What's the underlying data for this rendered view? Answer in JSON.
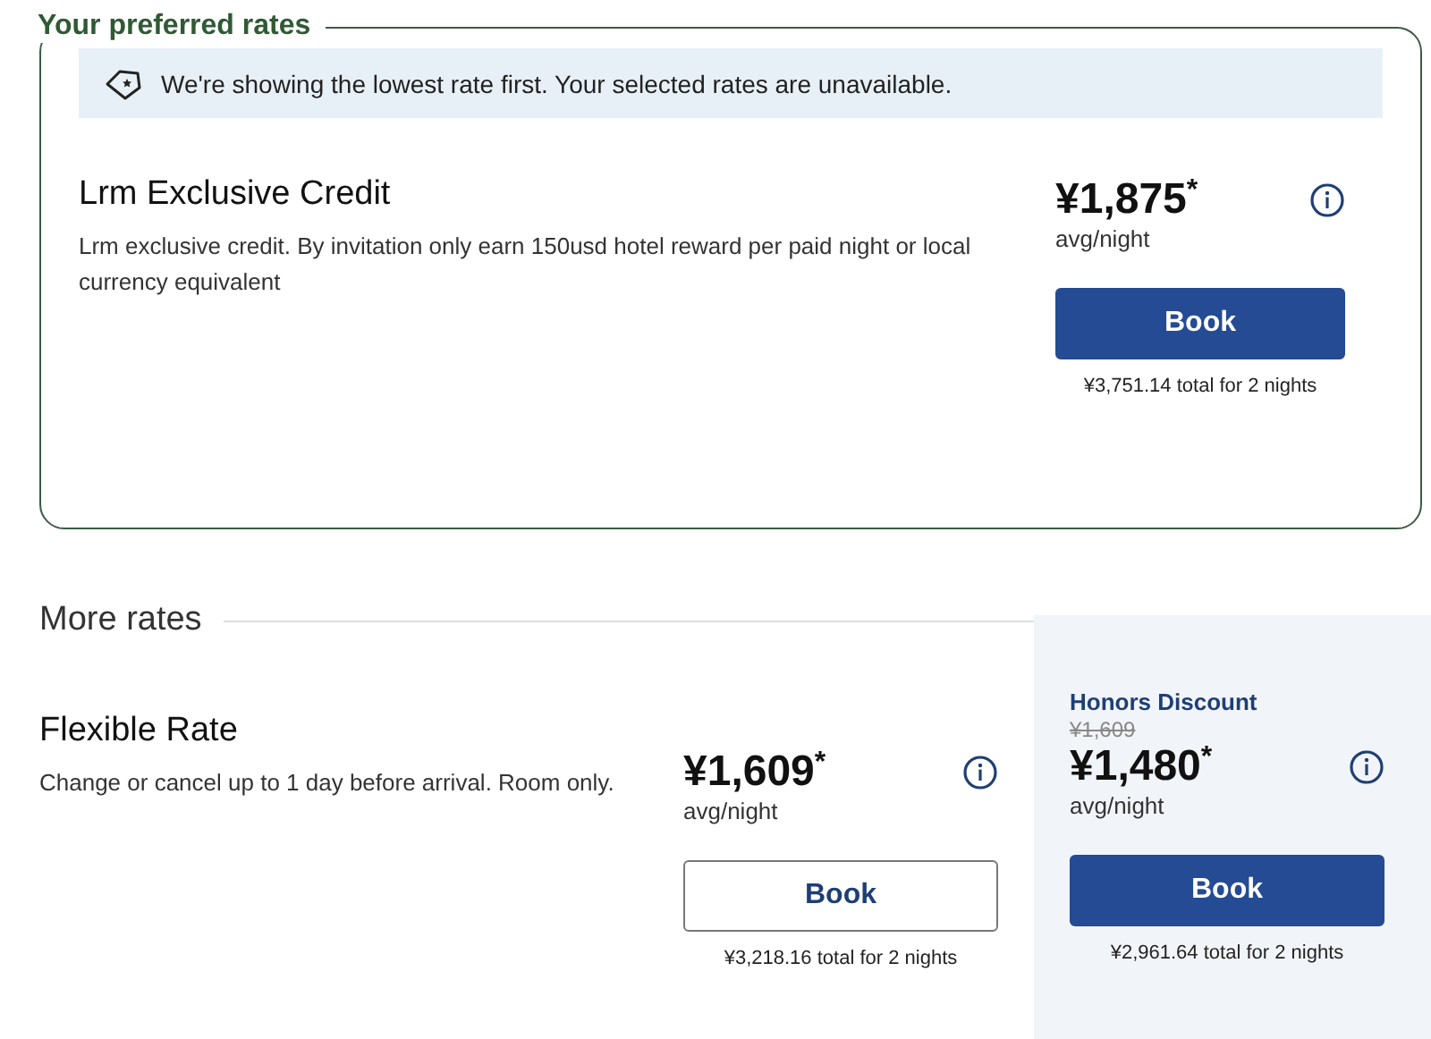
{
  "preferred": {
    "legend": "Your preferred rates",
    "notice": "We're showing the lowest rate first. Your selected rates are unavailable.",
    "rate": {
      "name": "Lrm Exclusive Credit",
      "description": "Lrm exclusive credit. By invitation only earn 150usd hotel reward per paid night or local currency equivalent",
      "offers": [
        {
          "price": "¥1,875$^{*}$",
          "unit": "avg/night",
          "button": {
            "label": "Book",
            "kind": "filled"
          },
          "total": "¥3,751.14 total for 2 nights"
        }
      ]
    }
  },
  "more": {
    "heading": "More rates",
    "rate": {
      "name": "Flexible Rate",
      "description": "Change or cancel up to 1 day before arrival. Room only.",
      "offers": [
        {
          "kind": "standard",
          "price": "¥1,609$^{*}$",
          "unit": "avg/night",
          "button": {
            "label": "Book",
            "kind": "outline"
          },
          "total": "¥3,218.16 total for 2 nights"
        },
        {
          "kind": "member",
          "label": "Honors Discount",
          "original_price": "¥1,609",
          "price": "¥1,480$^{*}$",
          "unit": "avg/night",
          "button": {
            "label": "Book",
            "kind": "filled"
          },
          "total": "¥2,961.64 total for 2 nights"
        }
      ]
    }
  }
}
